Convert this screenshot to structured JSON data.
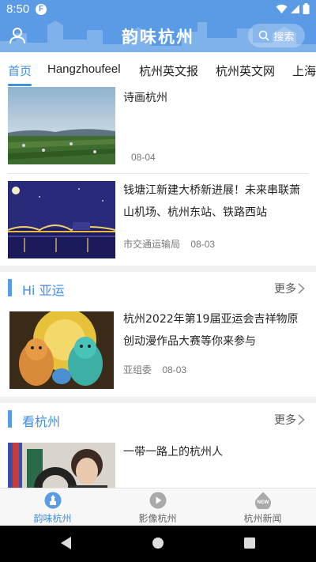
{
  "status_bar": {
    "time": "8:50",
    "notification_letter": "F"
  },
  "header": {
    "title": "韵味杭州",
    "search_label": "搜索"
  },
  "tabs": [
    {
      "label": "首页",
      "active": true
    },
    {
      "label": "Hangzhoufeel",
      "active": false
    },
    {
      "label": "杭州英文报",
      "active": false
    },
    {
      "label": "杭州英文网",
      "active": false
    },
    {
      "label": "上海",
      "active": false
    }
  ],
  "feed": {
    "top_items": [
      {
        "title": "诗画杭州",
        "source": "",
        "date": "08-04",
        "image": "landscape-photo"
      },
      {
        "title": "钱塘江新建大桥新进展！未来串联萧山机场、杭州东站、铁路西站",
        "source": "市交通运输局",
        "date": "08-03",
        "image": "bridge-night-illustration"
      }
    ],
    "sections": [
      {
        "title": "Hi 亚运",
        "more_label": "更多",
        "items": [
          {
            "title": "杭州2022年第19届亚运会吉祥物原创动漫作品大赛等你来参与",
            "source": "亚组委",
            "date": "08-03",
            "image": "mascot-cartoon"
          }
        ]
      },
      {
        "title": "看杭州",
        "more_label": "更多",
        "items": [
          {
            "title": "一带一路上的杭州人",
            "source": "",
            "date": "",
            "image": "person-photo"
          }
        ]
      }
    ]
  },
  "bottom_nav": [
    {
      "label": "韵味杭州",
      "icon": "home-tower-icon",
      "active": true
    },
    {
      "label": "影像杭州",
      "icon": "play-icon",
      "active": false
    },
    {
      "label": "杭州新闻",
      "icon": "new-badge-icon",
      "active": false
    }
  ],
  "colors": {
    "brand_blue": "#5B9BE6",
    "accent_blue": "#3F8EE0"
  }
}
